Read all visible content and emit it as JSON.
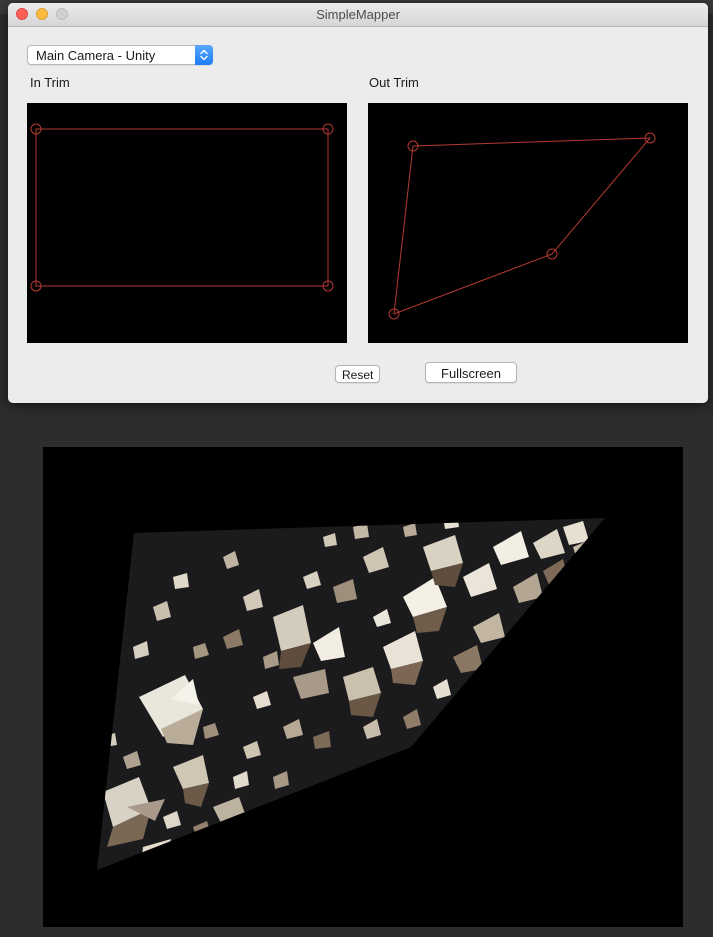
{
  "window": {
    "title": "SimpleMapper"
  },
  "source_select": {
    "selected": "Main Camera - Unity"
  },
  "in_trim": {
    "label": "In Trim"
  },
  "out_trim": {
    "label": "Out Trim"
  },
  "buttons": {
    "reset_label": "Reset",
    "fullscreen_label": "Fullscreen"
  },
  "colors": {
    "handle": "#b33a32",
    "accent": "#1c7cf4",
    "background": "#000000"
  },
  "icons": {
    "close": "close-icon",
    "minimize": "minimize-icon",
    "zoom": "zoom-icon",
    "popup": "updown-chevron-icon",
    "handle": "corner-handle-icon"
  }
}
